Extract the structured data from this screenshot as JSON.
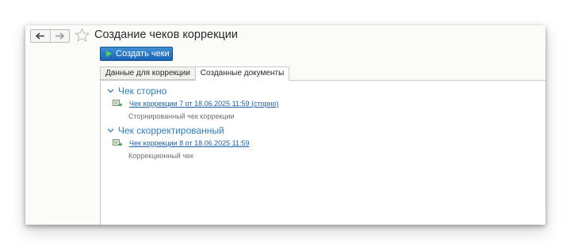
{
  "window": {
    "title": "Создание чеков коррекции"
  },
  "toolbar": {
    "create_label": "Создать чеки",
    "accent": "#1b64b4"
  },
  "tabs": [
    {
      "label": "Данные для коррекции",
      "active": false
    },
    {
      "label": "Созданные документы",
      "active": true
    }
  ],
  "groups": [
    {
      "title": "Чек сторно",
      "document_link": "Чек коррекции 7 от 18.06.2025 11:59 (сторно)",
      "description": "Сторнированный чек коррекции"
    },
    {
      "title": "Чек скорректированный",
      "document_link": "Чек коррекции 8 от 18.06.2025 11:59",
      "description": "Коррекционный чек"
    }
  ],
  "colors": {
    "group_header": "#2e7fc0",
    "link": "#1f5faa",
    "description": "#707070"
  }
}
